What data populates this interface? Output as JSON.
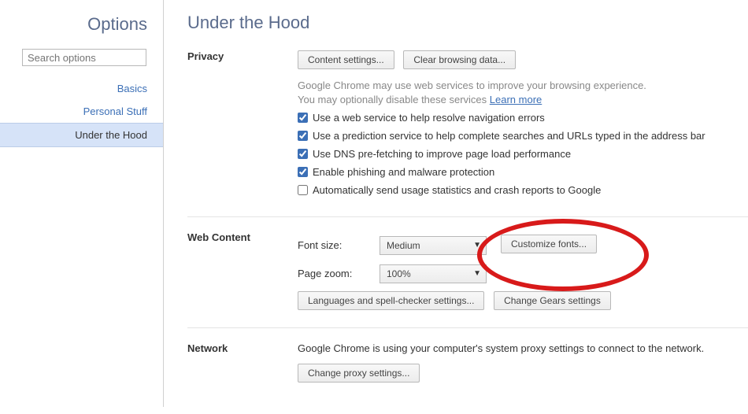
{
  "sidebar": {
    "title": "Options",
    "search_placeholder": "Search options",
    "nav": [
      {
        "label": "Basics"
      },
      {
        "label": "Personal Stuff"
      },
      {
        "label": "Under the Hood"
      }
    ]
  },
  "main": {
    "title": "Under the Hood",
    "privacy": {
      "heading": "Privacy",
      "buttons": {
        "content_settings": "Content settings...",
        "clear_browsing": "Clear browsing data..."
      },
      "desc_line1": "Google Chrome may use web services to improve your browsing experience.",
      "desc_line2": "You may optionally disable these services ",
      "learn_more": "Learn more",
      "checkboxes": [
        {
          "checked": true,
          "label": "Use a web service to help resolve navigation errors"
        },
        {
          "checked": true,
          "label": "Use a prediction service to help complete searches and URLs typed in the address bar"
        },
        {
          "checked": true,
          "label": "Use DNS pre-fetching to improve page load performance"
        },
        {
          "checked": true,
          "label": "Enable phishing and malware protection"
        },
        {
          "checked": false,
          "label": "Automatically send usage statistics and crash reports to Google"
        }
      ]
    },
    "web_content": {
      "heading": "Web Content",
      "font_size_label": "Font size:",
      "font_size_value": "Medium",
      "customize_fonts": "Customize fonts...",
      "page_zoom_label": "Page zoom:",
      "page_zoom_value": "100%",
      "lang_button": "Languages and spell-checker settings...",
      "gears_button": "Change Gears settings"
    },
    "network": {
      "heading": "Network",
      "desc": "Google Chrome is using your computer's system proxy settings to connect to the network.",
      "proxy_button": "Change proxy settings..."
    }
  }
}
